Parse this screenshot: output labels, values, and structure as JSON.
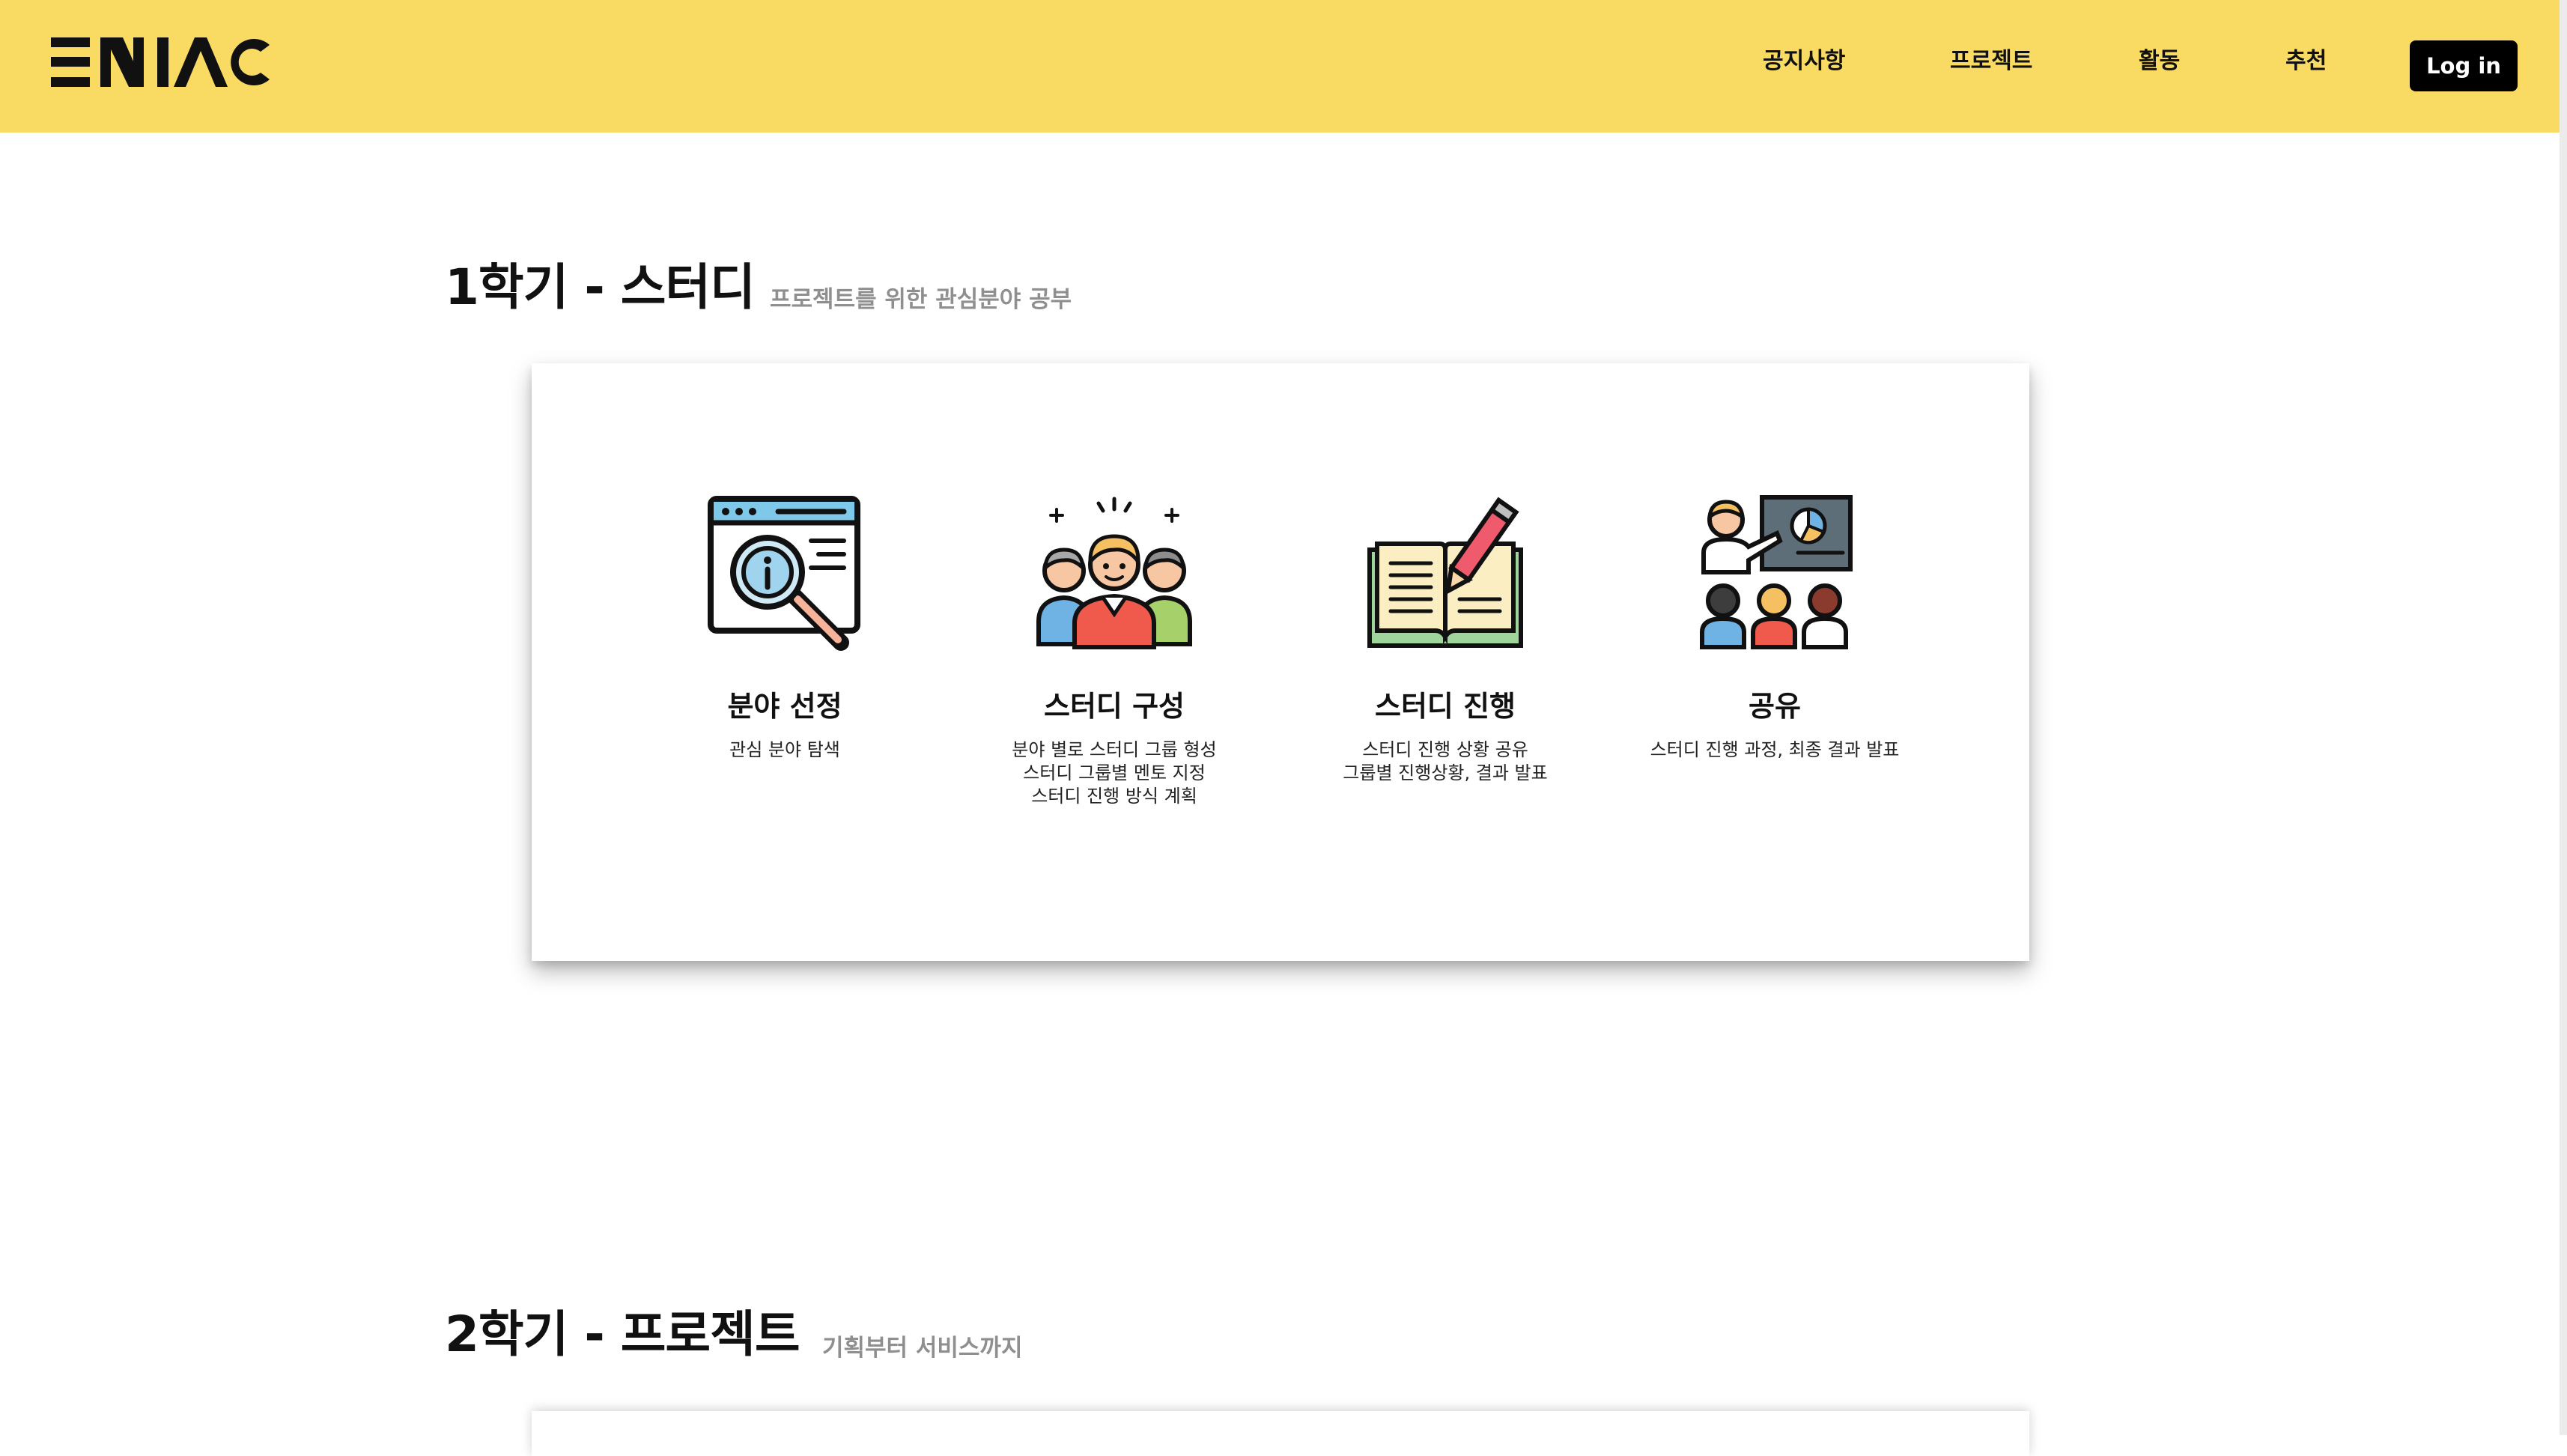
{
  "header": {
    "logo_text": "ENIAC",
    "nav": [
      "공지사항",
      "프로젝트",
      "활동",
      "추천"
    ],
    "login_label": "Log in"
  },
  "sections": [
    {
      "title": "1학기 - 스터디",
      "subtitle": "프로젝트를 위한 관심분야 공부",
      "steps": [
        {
          "icon": "magnifier-browser-icon",
          "title": "분야 선정",
          "desc": "관심 분야 탐색"
        },
        {
          "icon": "group-people-icon",
          "title": "스터디 구성",
          "desc": "분야 별로 스터디 그룹 형성\n스터디 그룹별 멘토 지정\n스터디 진행 방식 계획"
        },
        {
          "icon": "open-book-pencil-icon",
          "title": "스터디 진행",
          "desc": "스터디 진행 상황 공유\n그룹별 진행상황, 결과 발표"
        },
        {
          "icon": "presentation-audience-icon",
          "title": "공유",
          "desc": "스터디 진행 과정, 최종 결과 발표"
        }
      ]
    },
    {
      "title": "2학기 - 프로젝트",
      "subtitle": "기획부터 서비스까지"
    }
  ],
  "colors": {
    "header_bg": "#f9db63",
    "login_bg": "#000000",
    "subtitle": "#8f8f8f"
  }
}
